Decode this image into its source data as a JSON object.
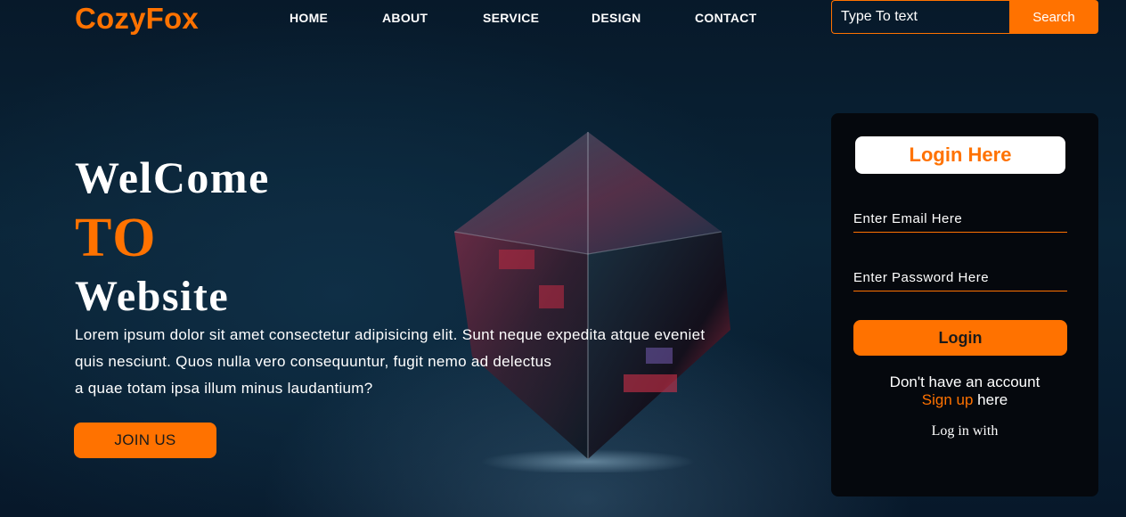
{
  "header": {
    "logo": "CozyFox",
    "nav": [
      {
        "label": "HOME"
      },
      {
        "label": "ABOUT"
      },
      {
        "label": "SERVICE"
      },
      {
        "label": "DESIGN"
      },
      {
        "label": "CONTACT"
      }
    ],
    "search": {
      "placeholder": "Type To text",
      "button_label": "Search"
    }
  },
  "hero": {
    "title_line1": "WelCome",
    "title_line2": "TO",
    "title_line3": "Website",
    "paragraph_lines": [
      "Lorem ipsum dolor sit amet consectetur adipisicing elit. Sunt neque expedita atque eveniet",
      "quis nesciunt. Quos nulla vero consequuntur, fugit nemo ad delectus",
      "a quae totam ipsa illum minus laudantium?"
    ],
    "cta_label": "JOIN US"
  },
  "login": {
    "heading": "Login Here",
    "email_placeholder": "Enter Email Here",
    "password_placeholder": "Enter Password Here",
    "button_label": "Login",
    "no_account_text": "Don't have an account",
    "signup_link": "Sign up",
    "signup_suffix": " here",
    "login_with": "Log in with"
  },
  "colors": {
    "accent": "#ff7200",
    "background": "#0a2437",
    "panel": "#05080d"
  }
}
